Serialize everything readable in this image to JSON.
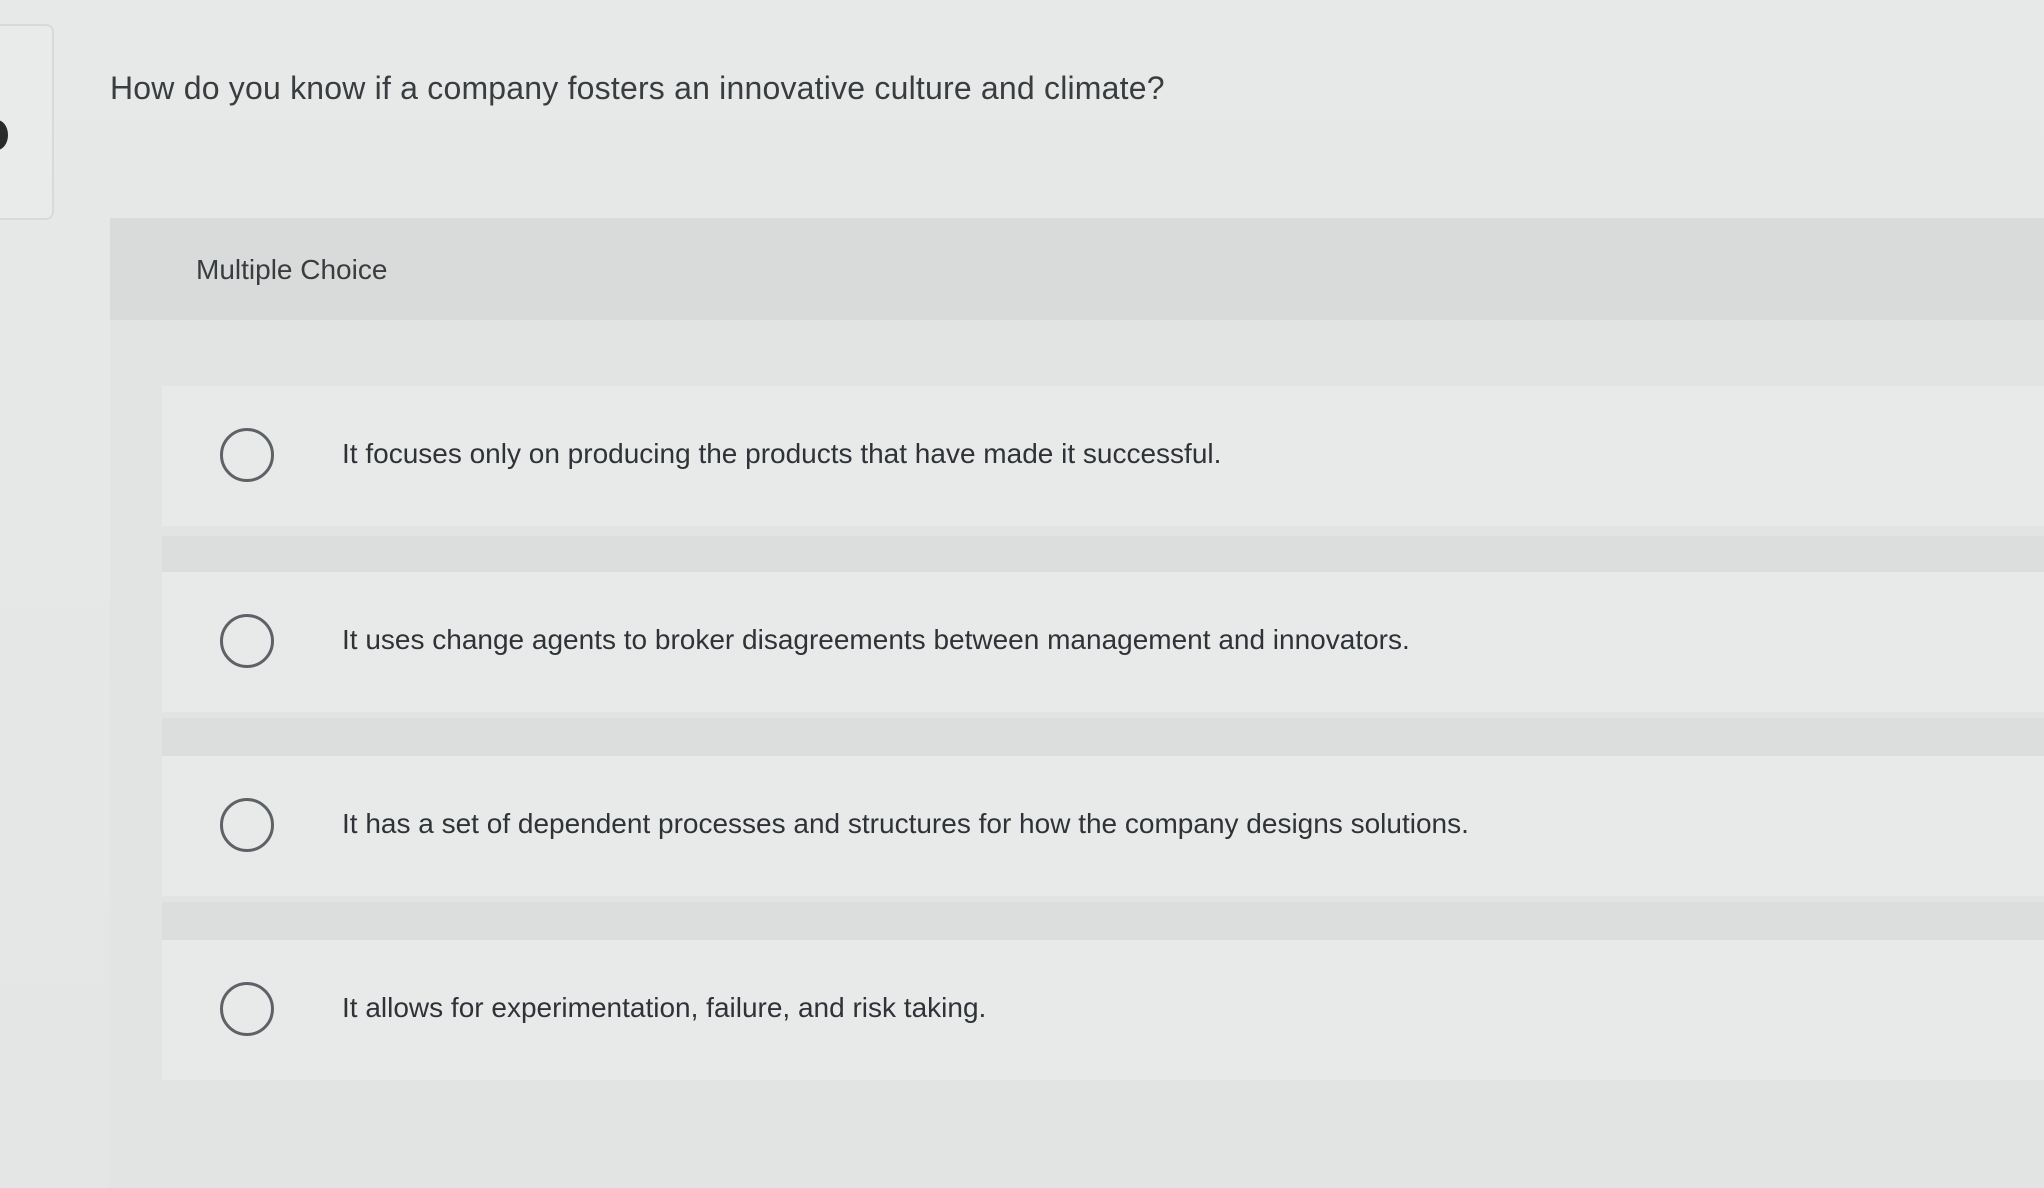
{
  "question": {
    "text": "How do you know if a company fosters an innovative culture and climate?"
  },
  "card": {
    "type_label": "Multiple Choice",
    "options": [
      {
        "text": "It focuses only on producing the products that have made it successful.",
        "selected": false
      },
      {
        "text": "It uses change agents to broker disagreements between management and innovators.",
        "selected": false
      },
      {
        "text": "It has a set of dependent processes and structures for how the company designs solutions.",
        "selected": false
      },
      {
        "text": "It allows for experimentation, failure, and risk taking.",
        "selected": false
      }
    ]
  }
}
